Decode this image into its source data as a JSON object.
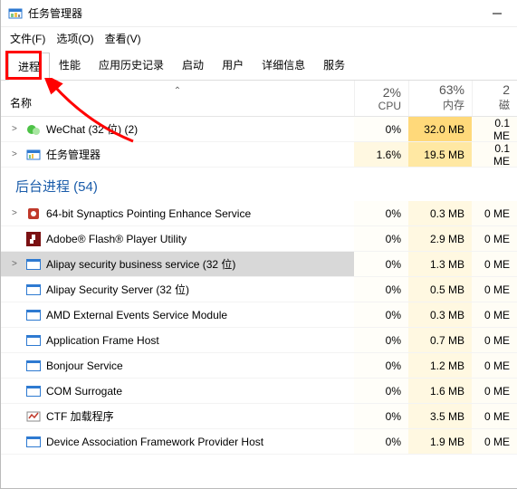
{
  "window": {
    "title": "任务管理器"
  },
  "menu": {
    "file": "文件(F)",
    "options": "选项(O)",
    "view": "查看(V)"
  },
  "tabs": {
    "processes": "进程",
    "performance": "性能",
    "app_history": "应用历史记录",
    "startup": "启动",
    "users": "用户",
    "details": "详细信息",
    "services": "服务"
  },
  "columns": {
    "name": "名称",
    "cpu_pct": "2%",
    "cpu_label": "CPU",
    "mem_pct": "63%",
    "mem_label": "内存",
    "disk_pct": "2",
    "disk_label": "磁"
  },
  "group": {
    "background_title": "后台进程 (54)"
  },
  "rows": [
    {
      "expand": true,
      "icon": "wechat",
      "name": "WeChat (32 位) (2)",
      "cpu": "0%",
      "mem": "32.0 MB",
      "disk": "0.1 ME",
      "mem_heat": "heat-hi",
      "cpu_heat": "heat-none",
      "selected": false
    },
    {
      "expand": true,
      "icon": "tm",
      "name": "任务管理器",
      "cpu": "1.6%",
      "mem": "19.5 MB",
      "disk": "0.1 ME",
      "mem_heat": "heat-med",
      "cpu_heat": "heat-low",
      "selected": false
    }
  ],
  "bg_rows": [
    {
      "expand": true,
      "icon": "syn",
      "name": "64-bit Synaptics Pointing Enhance Service",
      "cpu": "0%",
      "mem": "0.3 MB",
      "disk": "0 ME"
    },
    {
      "expand": false,
      "icon": "flash",
      "name": "Adobe® Flash® Player Utility",
      "cpu": "0%",
      "mem": "2.9 MB",
      "disk": "0 ME"
    },
    {
      "expand": true,
      "icon": "frame",
      "name": "Alipay security business service (32 位)",
      "cpu": "0%",
      "mem": "1.3 MB",
      "disk": "0 ME",
      "selected": true
    },
    {
      "expand": false,
      "icon": "frame",
      "name": "Alipay Security Server (32 位)",
      "cpu": "0%",
      "mem": "0.5 MB",
      "disk": "0 ME"
    },
    {
      "expand": false,
      "icon": "frame",
      "name": "AMD External Events Service Module",
      "cpu": "0%",
      "mem": "0.3 MB",
      "disk": "0 ME"
    },
    {
      "expand": false,
      "icon": "frame",
      "name": "Application Frame Host",
      "cpu": "0%",
      "mem": "0.7 MB",
      "disk": "0 ME"
    },
    {
      "expand": false,
      "icon": "frame",
      "name": "Bonjour Service",
      "cpu": "0%",
      "mem": "1.2 MB",
      "disk": "0 ME"
    },
    {
      "expand": false,
      "icon": "frame",
      "name": "COM Surrogate",
      "cpu": "0%",
      "mem": "1.6 MB",
      "disk": "0 ME"
    },
    {
      "expand": false,
      "icon": "ctf",
      "name": "CTF 加载程序",
      "cpu": "0%",
      "mem": "3.5 MB",
      "disk": "0 ME"
    },
    {
      "expand": false,
      "icon": "frame",
      "name": "Device Association Framework Provider Host",
      "cpu": "0%",
      "mem": "1.9 MB",
      "disk": "0 ME"
    }
  ]
}
